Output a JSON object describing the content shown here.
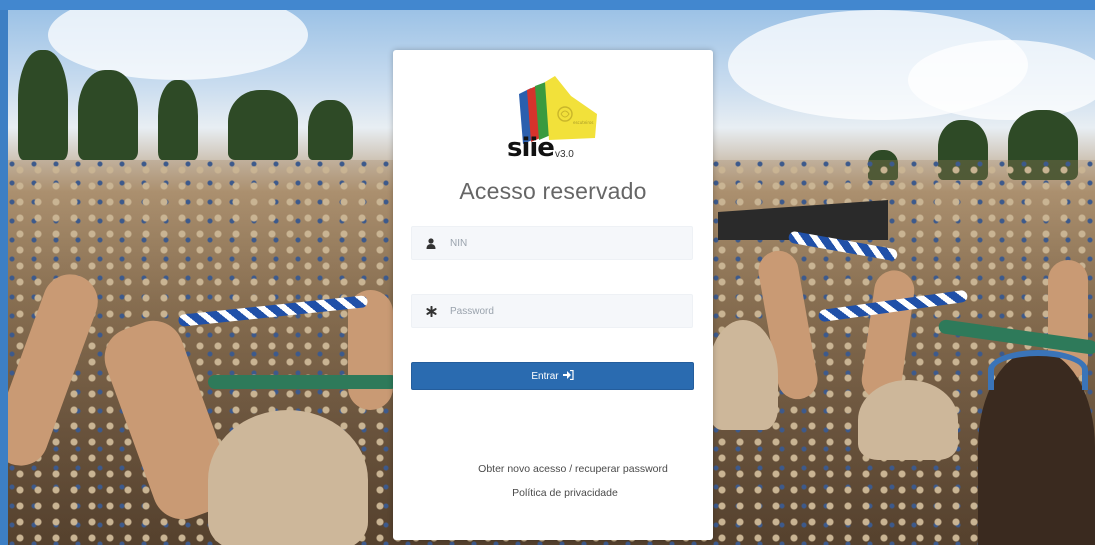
{
  "login": {
    "brand": "siie",
    "version": "v3.0",
    "heading": "Acesso reservado",
    "nin_placeholder": "NIN",
    "password_placeholder": "Password",
    "submit_label": "Entrar",
    "recover_link": "Obter novo acesso / recuperar password",
    "privacy_link": "Política de privacidade"
  },
  "icons": {
    "nin": "user-icon",
    "password": "asterisk-icon",
    "submit": "sign-in-icon"
  },
  "colors": {
    "primary": "#2a6bb0",
    "frame": "#4287cf",
    "logo_yellow": "#f2e13a",
    "logo_green": "#3a9a3f",
    "logo_red": "#d6332c",
    "logo_blue": "#2b5fae"
  }
}
